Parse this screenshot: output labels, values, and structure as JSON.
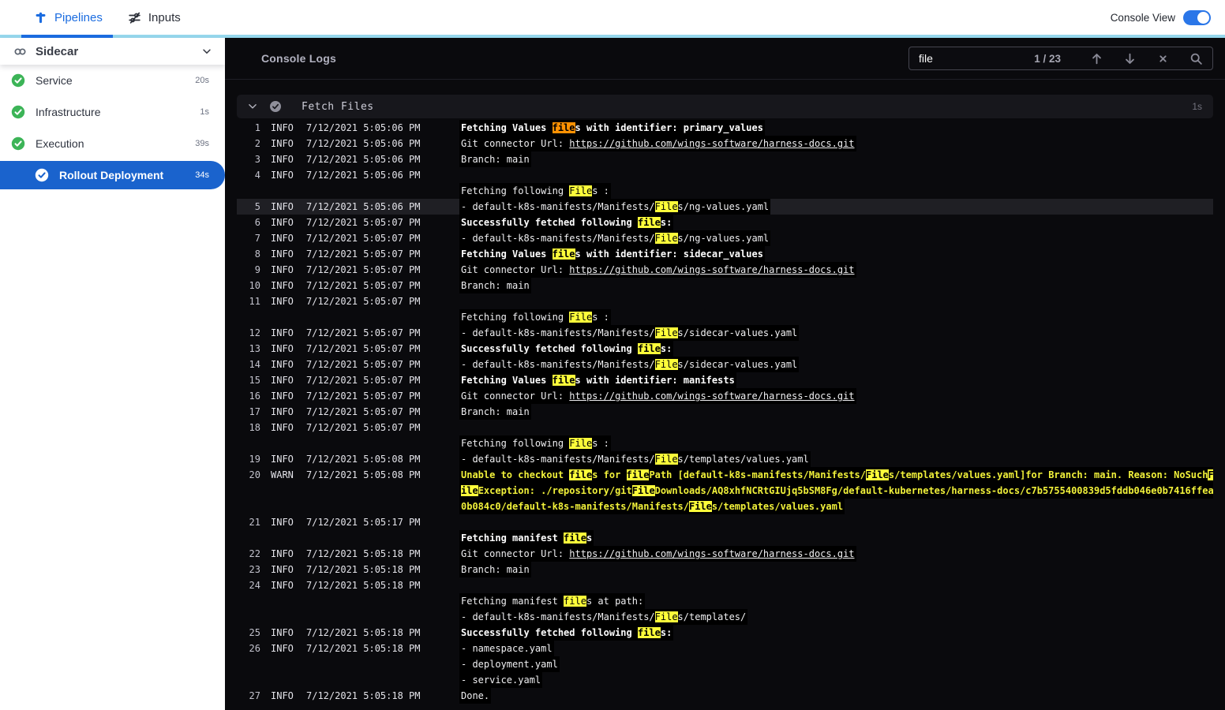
{
  "topbar": {
    "tabs": [
      {
        "label": "Pipelines"
      },
      {
        "label": "Inputs"
      }
    ],
    "console_view_label": "Console View",
    "console_view_on": true
  },
  "sidebar": {
    "title": "Sidecar",
    "stages": [
      {
        "id": "service",
        "label": "Service",
        "duration": "20s",
        "status": "success",
        "selected": false
      },
      {
        "id": "infrastructure",
        "label": "Infrastructure",
        "duration": "1s",
        "status": "success",
        "selected": false
      },
      {
        "id": "execution",
        "label": "Execution",
        "duration": "39s",
        "status": "success",
        "selected": false
      },
      {
        "id": "rollout-deployment",
        "label": "Rollout Deployment",
        "duration": "34s",
        "status": "success",
        "selected": true
      }
    ]
  },
  "console": {
    "title": "Console Logs",
    "search": {
      "value": "file",
      "counter": "1 / 23"
    },
    "section": {
      "title": "Fetch Files",
      "duration": "1s"
    },
    "logs": [
      {
        "n": 1,
        "lv": "INFO",
        "ts": "7/12/2021 5:05:06 PM",
        "rows": [
          {
            "b": 1,
            "s": [
              "Fetching Values ",
              {
                "t": "file",
                "h": "o"
              },
              "s with identifier: primary_values"
            ]
          }
        ]
      },
      {
        "n": 2,
        "lv": "INFO",
        "ts": "7/12/2021 5:05:06 PM",
        "rows": [
          {
            "s": [
              "Git connector Url: ",
              {
                "t": "https://github.com/wings-software/harness-docs.git",
                "l": 1
              }
            ]
          }
        ]
      },
      {
        "n": 3,
        "lv": "INFO",
        "ts": "7/12/2021 5:05:06 PM",
        "rows": [
          {
            "s": [
              "Branch: main"
            ]
          }
        ]
      },
      {
        "n": 4,
        "lv": "INFO",
        "ts": "7/12/2021 5:05:06 PM",
        "rows": [
          {
            "s": []
          },
          {
            "s": [
              "Fetching following ",
              {
                "t": "File",
                "h": "y"
              },
              "s :"
            ]
          }
        ]
      },
      {
        "n": 5,
        "lv": "INFO",
        "ts": "7/12/2021 5:05:06 PM",
        "sel": 1,
        "rows": [
          {
            "s": [
              "- default-k8s-manifests/Manifests/",
              {
                "t": "File",
                "h": "y"
              },
              "s/ng-values.yaml"
            ]
          }
        ]
      },
      {
        "n": 6,
        "lv": "INFO",
        "ts": "7/12/2021 5:05:07 PM",
        "rows": [
          {
            "b": 1,
            "s": [
              "Successfully fetched following ",
              {
                "t": "file",
                "h": "y"
              },
              "s:"
            ]
          }
        ]
      },
      {
        "n": 7,
        "lv": "INFO",
        "ts": "7/12/2021 5:05:07 PM",
        "rows": [
          {
            "s": [
              "- default-k8s-manifests/Manifests/",
              {
                "t": "File",
                "h": "y"
              },
              "s/ng-values.yaml"
            ]
          }
        ]
      },
      {
        "n": 8,
        "lv": "INFO",
        "ts": "7/12/2021 5:05:07 PM",
        "rows": [
          {
            "b": 1,
            "s": [
              "Fetching Values ",
              {
                "t": "file",
                "h": "y"
              },
              "s with identifier: sidecar_values"
            ]
          }
        ]
      },
      {
        "n": 9,
        "lv": "INFO",
        "ts": "7/12/2021 5:05:07 PM",
        "rows": [
          {
            "s": [
              "Git connector Url: ",
              {
                "t": "https://github.com/wings-software/harness-docs.git",
                "l": 1
              }
            ]
          }
        ]
      },
      {
        "n": 10,
        "lv": "INFO",
        "ts": "7/12/2021 5:05:07 PM",
        "rows": [
          {
            "s": [
              "Branch: main"
            ]
          }
        ]
      },
      {
        "n": 11,
        "lv": "INFO",
        "ts": "7/12/2021 5:05:07 PM",
        "rows": [
          {
            "s": []
          },
          {
            "s": [
              "Fetching following ",
              {
                "t": "File",
                "h": "y"
              },
              "s :"
            ]
          }
        ]
      },
      {
        "n": 12,
        "lv": "INFO",
        "ts": "7/12/2021 5:05:07 PM",
        "rows": [
          {
            "s": [
              "- default-k8s-manifests/Manifests/",
              {
                "t": "File",
                "h": "y"
              },
              "s/sidecar-values.yaml"
            ]
          }
        ]
      },
      {
        "n": 13,
        "lv": "INFO",
        "ts": "7/12/2021 5:05:07 PM",
        "rows": [
          {
            "b": 1,
            "s": [
              "Successfully fetched following ",
              {
                "t": "file",
                "h": "y"
              },
              "s:"
            ]
          }
        ]
      },
      {
        "n": 14,
        "lv": "INFO",
        "ts": "7/12/2021 5:05:07 PM",
        "rows": [
          {
            "s": [
              "- default-k8s-manifests/Manifests/",
              {
                "t": "File",
                "h": "y"
              },
              "s/sidecar-values.yaml"
            ]
          }
        ]
      },
      {
        "n": 15,
        "lv": "INFO",
        "ts": "7/12/2021 5:05:07 PM",
        "rows": [
          {
            "b": 1,
            "s": [
              "Fetching Values ",
              {
                "t": "file",
                "h": "y"
              },
              "s with identifier: manifests"
            ]
          }
        ]
      },
      {
        "n": 16,
        "lv": "INFO",
        "ts": "7/12/2021 5:05:07 PM",
        "rows": [
          {
            "s": [
              "Git connector Url: ",
              {
                "t": "https://github.com/wings-software/harness-docs.git",
                "l": 1
              }
            ]
          }
        ]
      },
      {
        "n": 17,
        "lv": "INFO",
        "ts": "7/12/2021 5:05:07 PM",
        "rows": [
          {
            "s": [
              "Branch: main"
            ]
          }
        ]
      },
      {
        "n": 18,
        "lv": "INFO",
        "ts": "7/12/2021 5:05:07 PM",
        "rows": [
          {
            "s": []
          },
          {
            "s": [
              "Fetching following ",
              {
                "t": "File",
                "h": "y"
              },
              "s :"
            ]
          }
        ]
      },
      {
        "n": 19,
        "lv": "INFO",
        "ts": "7/12/2021 5:05:08 PM",
        "rows": [
          {
            "s": [
              "- default-k8s-manifests/Manifests/",
              {
                "t": "File",
                "h": "y"
              },
              "s/templates/values.yaml"
            ]
          }
        ]
      },
      {
        "n": 20,
        "lv": "WARN",
        "ts": "7/12/2021 5:05:08 PM",
        "rows": [
          {
            "s": [
              "Unable to checkout ",
              {
                "t": "file",
                "h": "y"
              },
              "s for ",
              {
                "t": "file",
                "h": "y"
              },
              "Path [default-k8s-manifests/Manifests/",
              {
                "t": "File",
                "h": "y"
              },
              "s/templates/values.yaml]for Branch: main. Reason: NoSuch",
              {
                "t": "F",
                "h": "y"
              }
            ]
          },
          {
            "s": [
              {
                "t": "ile",
                "h": "y"
              },
              "Exception: ./repository/git",
              {
                "t": "File",
                "h": "y"
              },
              "Downloads/AQ8xhfNCRtGIUjq5bSM8Fg/default-kubernetes/harness-docs/c7b5755400839d5fddb046e0b7416ffea"
            ]
          },
          {
            "s": [
              "0b084c0/default-k8s-manifests/Manifests/",
              {
                "t": "File",
                "h": "y"
              },
              "s/templates/values.yaml"
            ]
          }
        ]
      },
      {
        "n": 21,
        "lv": "INFO",
        "ts": "7/12/2021 5:05:17 PM",
        "rows": [
          {
            "s": []
          },
          {
            "b": 1,
            "s": [
              "Fetching manifest ",
              {
                "t": "file",
                "h": "y"
              },
              "s"
            ]
          }
        ]
      },
      {
        "n": 22,
        "lv": "INFO",
        "ts": "7/12/2021 5:05:18 PM",
        "rows": [
          {
            "s": [
              "Git connector Url: ",
              {
                "t": "https://github.com/wings-software/harness-docs.git",
                "l": 1
              }
            ]
          }
        ]
      },
      {
        "n": 23,
        "lv": "INFO",
        "ts": "7/12/2021 5:05:18 PM",
        "rows": [
          {
            "s": [
              "Branch: main"
            ]
          }
        ]
      },
      {
        "n": 24,
        "lv": "INFO",
        "ts": "7/12/2021 5:05:18 PM",
        "rows": [
          {
            "s": []
          },
          {
            "s": [
              "Fetching manifest ",
              {
                "t": "file",
                "h": "y"
              },
              "s at path:"
            ]
          },
          {
            "s": [
              "- default-k8s-manifests/Manifests/",
              {
                "t": "File",
                "h": "y"
              },
              "s/templates/"
            ]
          }
        ]
      },
      {
        "n": 25,
        "lv": "INFO",
        "ts": "7/12/2021 5:05:18 PM",
        "rows": [
          {
            "b": 1,
            "s": [
              "Successfully fetched following ",
              {
                "t": "file",
                "h": "y"
              },
              "s:"
            ]
          }
        ]
      },
      {
        "n": 26,
        "lv": "INFO",
        "ts": "7/12/2021 5:05:18 PM",
        "rows": [
          {
            "s": [
              "- namespace.yaml"
            ]
          },
          {
            "s": [
              "- deployment.yaml"
            ]
          },
          {
            "s": [
              "- service.yaml"
            ]
          }
        ]
      },
      {
        "n": 27,
        "lv": "INFO",
        "ts": "7/12/2021 5:05:18 PM",
        "rows": [
          {
            "s": [
              "Done."
            ]
          }
        ]
      }
    ]
  },
  "colors": {
    "accent_blue": "#1b6ce0",
    "selected_stage_blue": "#1a63cd",
    "success_green": "#3cb457",
    "console_bg": "#0a0a0d",
    "match_highlight": "#fcfc3a",
    "current_match_highlight": "#ff9102",
    "warn_text": "#f1f13a"
  }
}
